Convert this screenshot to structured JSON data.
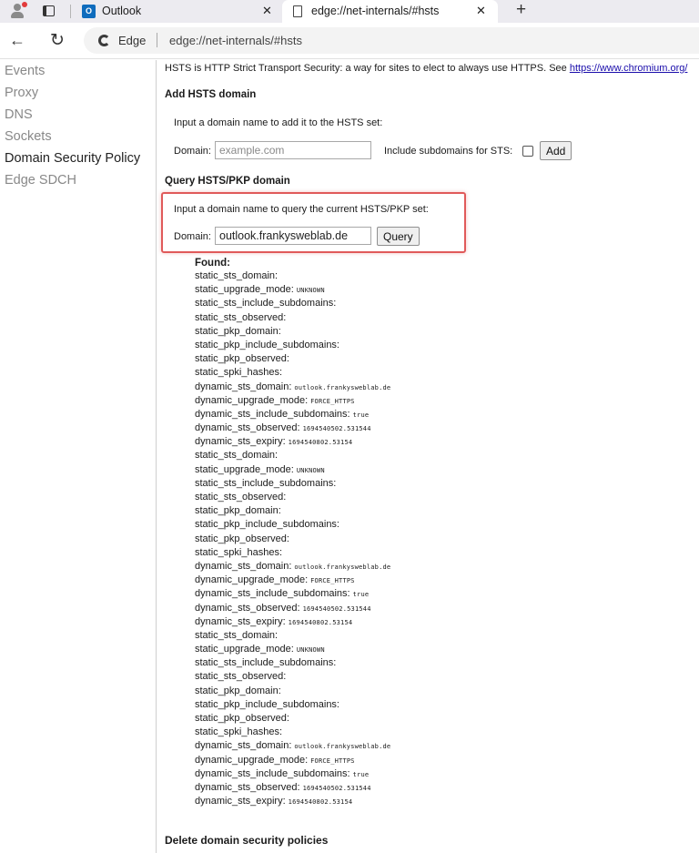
{
  "tabs": [
    {
      "title": "Outlook",
      "favicon": "outlook-icon",
      "close": "✕"
    },
    {
      "title": "edge://net-internals/#hsts",
      "favicon": "page-icon",
      "close": "✕"
    }
  ],
  "toolbar": {
    "browser_label": "Edge",
    "url": "edge://net-internals/#hsts"
  },
  "sidebar": {
    "items": [
      {
        "label": "Events"
      },
      {
        "label": "Proxy"
      },
      {
        "label": "DNS"
      },
      {
        "label": "Sockets"
      },
      {
        "label": "Domain Security Policy",
        "active": true
      },
      {
        "label": "Edge SDCH"
      }
    ]
  },
  "main": {
    "intro_text": "HSTS is HTTP Strict Transport Security: a way for sites to elect to always use HTTPS. See ",
    "intro_link": "https://www.chromium.org/",
    "add": {
      "heading": "Add HSTS domain",
      "instruction": "Input a domain name to add it to the HSTS set:",
      "domain_label": "Domain:",
      "domain_placeholder": "example.com",
      "subdomains_label": "Include subdomains for STS:",
      "button": "Add"
    },
    "query": {
      "heading": "Query HSTS/PKP domain",
      "instruction": "Input a domain name to query the current HSTS/PKP set:",
      "domain_label": "Domain:",
      "domain_value": "outlook.frankysweblab.de",
      "button": "Query",
      "highlight_color": "#e05a5a"
    },
    "results": {
      "found_label": "Found:",
      "rows": [
        {
          "key": "static_sts_domain:",
          "value": ""
        },
        {
          "key": "static_upgrade_mode:",
          "value": "UNKNOWN"
        },
        {
          "key": "static_sts_include_subdomains:",
          "value": ""
        },
        {
          "key": "static_sts_observed:",
          "value": ""
        },
        {
          "key": "static_pkp_domain:",
          "value": ""
        },
        {
          "key": "static_pkp_include_subdomains:",
          "value": ""
        },
        {
          "key": "static_pkp_observed:",
          "value": ""
        },
        {
          "key": "static_spki_hashes:",
          "value": ""
        },
        {
          "key": "dynamic_sts_domain:",
          "value": "outlook.frankysweblab.de"
        },
        {
          "key": "dynamic_upgrade_mode:",
          "value": "FORCE_HTTPS"
        },
        {
          "key": "dynamic_sts_include_subdomains:",
          "value": "true"
        },
        {
          "key": "dynamic_sts_observed:",
          "value": "1694540502.531544"
        },
        {
          "key": "dynamic_sts_expiry:",
          "value": "1694540802.53154"
        },
        {
          "key": "static_sts_domain:",
          "value": ""
        },
        {
          "key": "static_upgrade_mode:",
          "value": "UNKNOWN"
        },
        {
          "key": "static_sts_include_subdomains:",
          "value": ""
        },
        {
          "key": "static_sts_observed:",
          "value": ""
        },
        {
          "key": "static_pkp_domain:",
          "value": ""
        },
        {
          "key": "static_pkp_include_subdomains:",
          "value": ""
        },
        {
          "key": "static_pkp_observed:",
          "value": ""
        },
        {
          "key": "static_spki_hashes:",
          "value": ""
        },
        {
          "key": "dynamic_sts_domain:",
          "value": "outlook.frankysweblab.de"
        },
        {
          "key": "dynamic_upgrade_mode:",
          "value": "FORCE_HTTPS"
        },
        {
          "key": "dynamic_sts_include_subdomains:",
          "value": "true"
        },
        {
          "key": "dynamic_sts_observed:",
          "value": "1694540502.531544"
        },
        {
          "key": "dynamic_sts_expiry:",
          "value": "1694540802.53154"
        },
        {
          "key": "static_sts_domain:",
          "value": ""
        },
        {
          "key": "static_upgrade_mode:",
          "value": "UNKNOWN"
        },
        {
          "key": "static_sts_include_subdomains:",
          "value": ""
        },
        {
          "key": "static_sts_observed:",
          "value": ""
        },
        {
          "key": "static_pkp_domain:",
          "value": ""
        },
        {
          "key": "static_pkp_include_subdomains:",
          "value": ""
        },
        {
          "key": "static_pkp_observed:",
          "value": ""
        },
        {
          "key": "static_spki_hashes:",
          "value": ""
        },
        {
          "key": "dynamic_sts_domain:",
          "value": "outlook.frankysweblab.de"
        },
        {
          "key": "dynamic_upgrade_mode:",
          "value": "FORCE_HTTPS"
        },
        {
          "key": "dynamic_sts_include_subdomains:",
          "value": "true"
        },
        {
          "key": "dynamic_sts_observed:",
          "value": "1694540502.531544"
        },
        {
          "key": "dynamic_sts_expiry:",
          "value": "1694540802.53154"
        }
      ]
    },
    "delete_heading": "Delete domain security policies"
  },
  "icons": {
    "back": "←",
    "reload": "↻",
    "new_tab": "+"
  }
}
